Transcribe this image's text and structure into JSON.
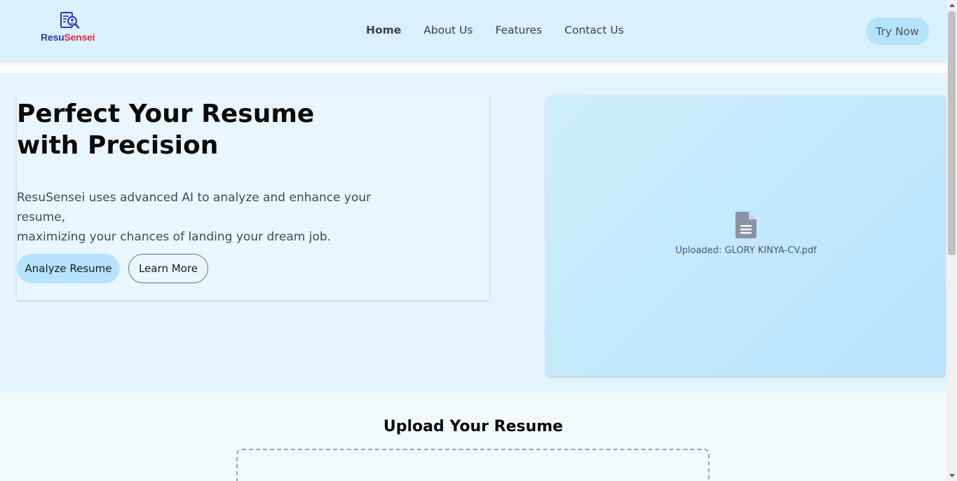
{
  "brand": {
    "name_part1": "Resu",
    "name_part2": "Sensei",
    "color1": "#1f3f9e",
    "color2": "#e0294a"
  },
  "nav": {
    "items": [
      {
        "label": "Home",
        "active": true
      },
      {
        "label": "About Us",
        "active": false
      },
      {
        "label": "Features",
        "active": false
      },
      {
        "label": "Contact Us",
        "active": false
      }
    ],
    "cta_label": "Try Now"
  },
  "hero": {
    "title_line1": "Perfect Your Resume",
    "title_line2": "with Precision",
    "description_line1": "ResuSensei uses advanced AI to analyze and enhance your resume,",
    "description_line2": "maximizing your chances of landing your dream job.",
    "primary_button": "Analyze Resume",
    "secondary_button": "Learn More"
  },
  "preview": {
    "icon": "file-text-icon",
    "uploaded_text": "Uploaded: GLORY KINYA-CV.pdf"
  },
  "upload": {
    "title": "Upload Your Resume"
  },
  "colors": {
    "accent": "#b5e3fb",
    "header_bg": "#daf0fd",
    "hero_bg": "#e3f4fe"
  }
}
